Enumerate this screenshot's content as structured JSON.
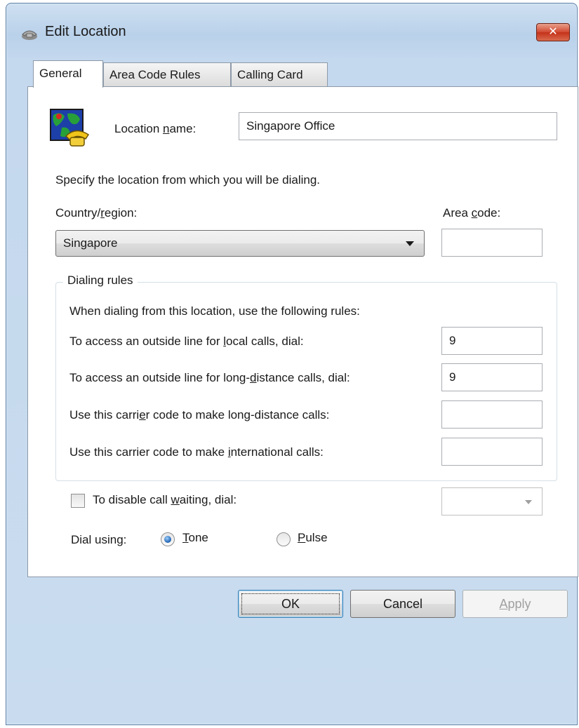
{
  "window": {
    "title": "Edit Location",
    "close_label": "✕"
  },
  "tabs": [
    {
      "label": "General",
      "active": true
    },
    {
      "label": "Area Code Rules",
      "active": false
    },
    {
      "label": "Calling Card",
      "active": false
    }
  ],
  "general": {
    "location_name_label_pre": "Location ",
    "location_name_label_mnemonic": "n",
    "location_name_label_post": "ame:",
    "location_name_value": "Singapore Office",
    "intro_text": "Specify the location from which you will be dialing.",
    "country_label_pre": "Country/",
    "country_label_mnemonic": "r",
    "country_label_post": "egion:",
    "country_value": "Singapore",
    "area_code_label_pre": "Area ",
    "area_code_label_mnemonic": "c",
    "area_code_label_post": "ode:",
    "area_code_value": ""
  },
  "dialing_rules": {
    "legend": "Dialing rules",
    "intro": "When dialing from this location, use the following rules:",
    "local_label_pre": "To access an outside line for ",
    "local_label_mnemonic": "l",
    "local_label_post": "ocal calls, dial:",
    "local_value": "9",
    "long_label_pre": "To access an outside line for long-",
    "long_label_mnemonic": "d",
    "long_label_post": "istance calls, dial:",
    "long_value": "9",
    "carrier_long_label_pre": "Use this carri",
    "carrier_long_label_mnemonic": "e",
    "carrier_long_label_post": "r code to make long-distance calls:",
    "carrier_long_value": "",
    "carrier_intl_label_pre": "Use this carrier code to make ",
    "carrier_intl_label_mnemonic": "i",
    "carrier_intl_label_post": "nternational calls:",
    "carrier_intl_value": ""
  },
  "call_waiting": {
    "label_pre": "To disable call ",
    "label_mnemonic": "w",
    "label_post": "aiting, dial:",
    "checked": false,
    "value": ""
  },
  "dial_using": {
    "label": "Dial using:",
    "tone_mnemonic": "T",
    "tone_rest": "one",
    "pulse_mnemonic": "P",
    "pulse_rest": "ulse",
    "selected": "Tone"
  },
  "buttons": {
    "ok": "OK",
    "cancel": "Cancel",
    "apply_mnemonic": "A",
    "apply_rest": "pply"
  },
  "colors": {
    "window_frame": "#b9d1ea",
    "close_button": "#c4321a",
    "radio_selected": "#1c5fae"
  }
}
